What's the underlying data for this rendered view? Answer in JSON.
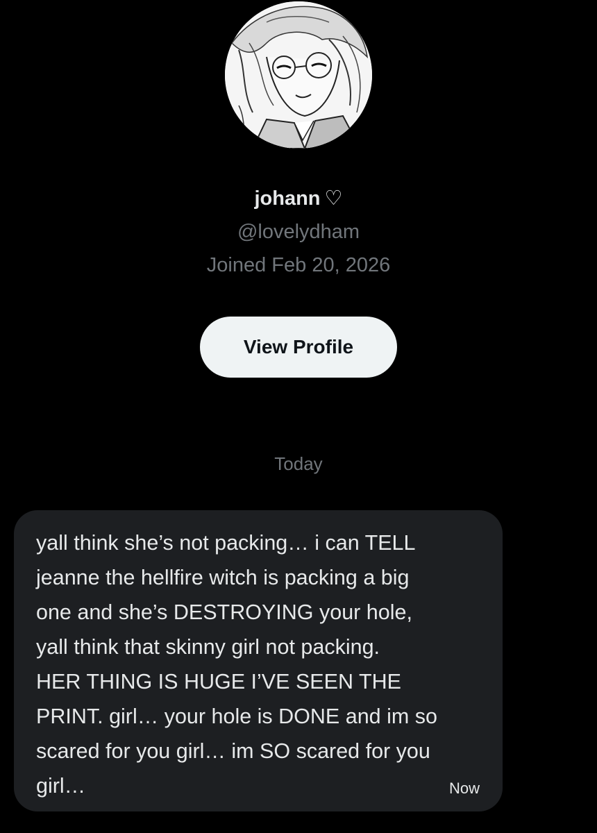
{
  "profile": {
    "avatar_icon": "anime-avatar",
    "display_name": "johann",
    "heart": "♡",
    "handle": "@lovelydham",
    "joined": "Joined Feb 20, 2026",
    "view_profile_label": "View Profile"
  },
  "conversation": {
    "date_divider": "Today",
    "messages": [
      {
        "lines": [
          "yall think she’s not packing… i can TELL",
          "jeanne the hellfire witch is packing a big",
          "one and she’s DESTROYING your hole,",
          "yall think that skinny girl not packing.",
          "HER THING IS HUGE I’VE SEEN THE",
          "PRINT. girl… your hole is DONE and im so",
          "scared for you girl… im SO scared for you",
          "girl…"
        ],
        "timestamp": "Now"
      }
    ]
  },
  "colors": {
    "background": "#000000",
    "bubble": "#1d1f22",
    "secondary_text": "#71767b",
    "button": "#eff3f4"
  }
}
